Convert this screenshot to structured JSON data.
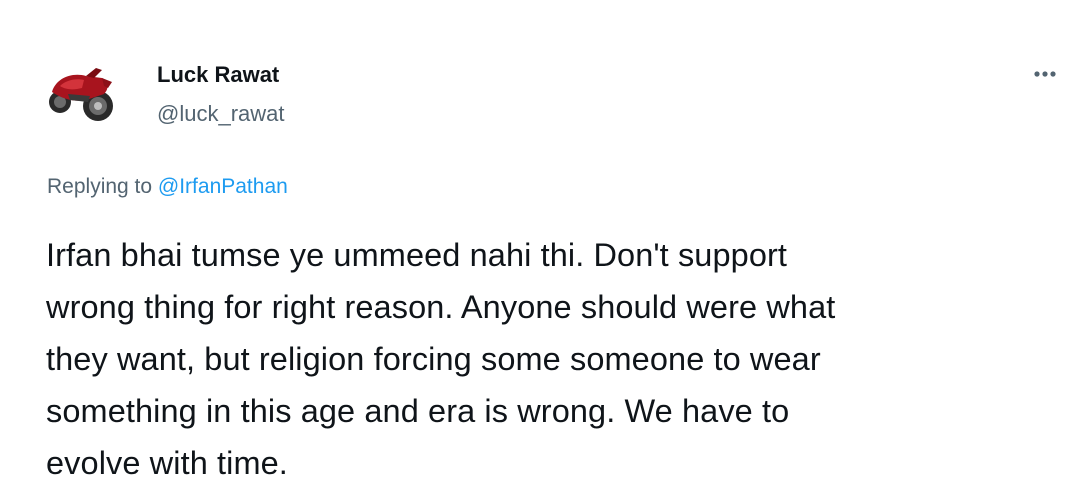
{
  "tweet": {
    "author": {
      "display_name": "Luck Rawat",
      "handle": "@luck_rawat",
      "avatar_icon": "motorcycle-avatar"
    },
    "more_icon": "more-horizontal-icon",
    "reply_context": {
      "prefix": "Replying to ",
      "mention": "@IrfanPathan"
    },
    "text": "Irfan bhai tumse ye ummeed nahi thi. Don't support\nwrong thing for right reason. Anyone should were what\nthey want, but religion forcing some someone to wear\nsomething in this age and era is wrong. We have to\nevolve with time."
  },
  "colors": {
    "text_primary": "#0f1419",
    "text_secondary": "#536471",
    "link": "#1d9bf0",
    "background": "#ffffff"
  }
}
